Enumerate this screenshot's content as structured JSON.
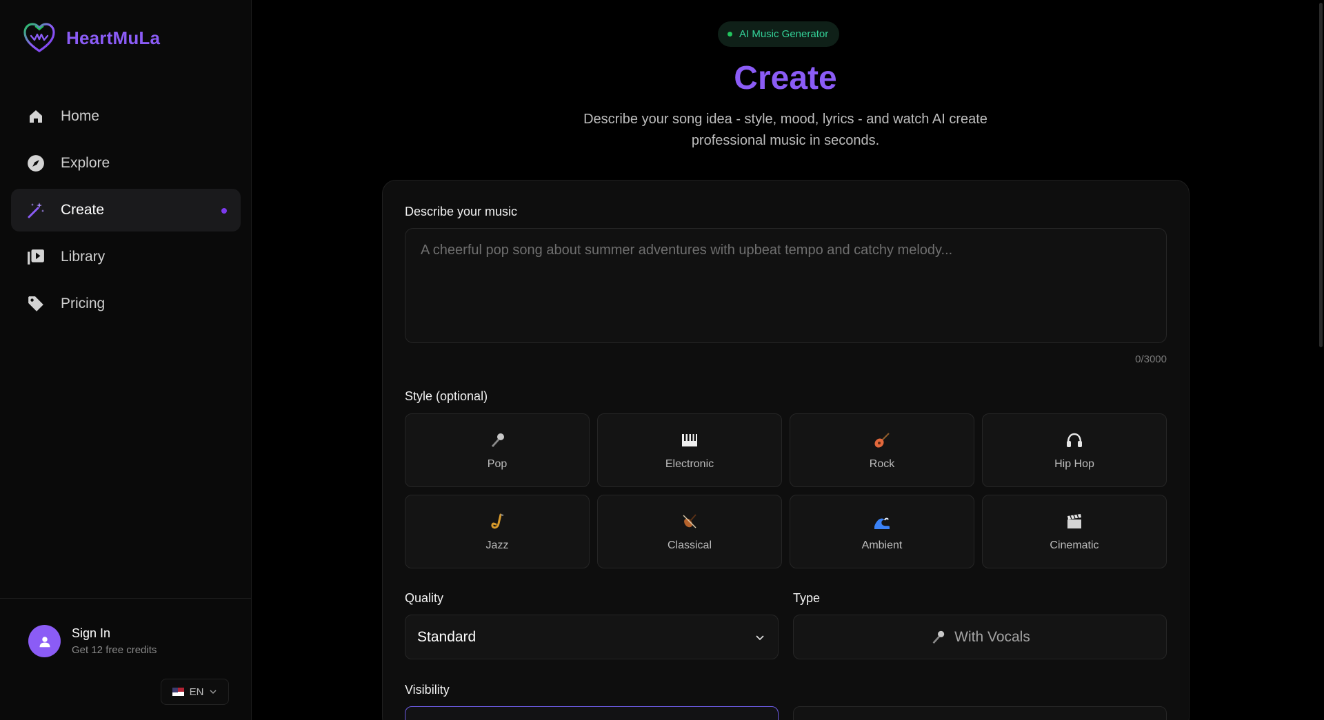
{
  "app": {
    "name": "HeartMuLa"
  },
  "sidebar": {
    "items": [
      {
        "label": "Home",
        "icon": "home-icon"
      },
      {
        "label": "Explore",
        "icon": "compass-icon"
      },
      {
        "label": "Create",
        "icon": "magic-wand-icon",
        "active": true
      },
      {
        "label": "Library",
        "icon": "library-icon"
      },
      {
        "label": "Pricing",
        "icon": "tag-icon"
      }
    ],
    "user": {
      "name": "Sign In",
      "subtitle": "Get 12 free credits"
    },
    "language": "EN"
  },
  "header": {
    "badge": "AI Music Generator",
    "title": "Create",
    "subtitle_line1": "Describe your song idea - style, mood, lyrics - and watch AI create",
    "subtitle_line2": "professional music in seconds."
  },
  "form": {
    "describe_label": "Describe your music",
    "describe_placeholder": "A cheerful pop song about summer adventures with upbeat tempo and catchy melody...",
    "char_counter": "0/3000",
    "style_label": "Style (optional)",
    "styles": [
      {
        "label": "Pop",
        "icon": "microphone-icon"
      },
      {
        "label": "Electronic",
        "icon": "piano-keys-icon"
      },
      {
        "label": "Rock",
        "icon": "guitar-icon"
      },
      {
        "label": "Hip Hop",
        "icon": "headphones-icon"
      },
      {
        "label": "Jazz",
        "icon": "saxophone-icon"
      },
      {
        "label": "Classical",
        "icon": "violin-icon"
      },
      {
        "label": "Ambient",
        "icon": "wave-icon"
      },
      {
        "label": "Cinematic",
        "icon": "clapperboard-icon"
      }
    ],
    "quality_label": "Quality",
    "quality_value": "Standard",
    "type_label": "Type",
    "type_value": "With Vocals",
    "visibility_label": "Visibility"
  },
  "colors": {
    "accent": "#8b5cf6",
    "badge_text": "#34d399",
    "background": "#000000"
  }
}
